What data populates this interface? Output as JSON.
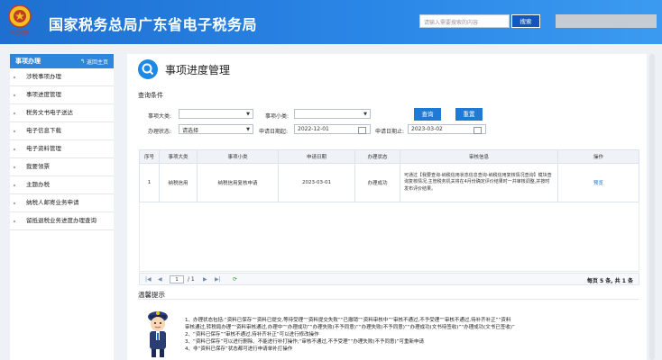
{
  "header": {
    "title": "国家税务总局广东省电子税务局",
    "emblem_text": "中国税务",
    "search_placeholder": "请输入需要搜索的内容",
    "search_button": "搜索"
  },
  "sidebar": {
    "title": "事项办理",
    "back_label": "返回主页",
    "items": [
      {
        "label": "涉税事项办理"
      },
      {
        "label": "事项进度管理"
      },
      {
        "label": "税务文书电子送达"
      },
      {
        "label": "电子信息下载"
      },
      {
        "label": "电子资料管理"
      },
      {
        "label": "我要领票"
      },
      {
        "label": "主题办税"
      },
      {
        "label": "纳税人邮寄业务申请"
      },
      {
        "label": "留抵退税业务进度办理查询"
      }
    ]
  },
  "page": {
    "title": "事项进度管理",
    "query_section": "查询条件"
  },
  "filters": {
    "category_label": "事项大类:",
    "category_value": "",
    "subcategory_label": "事项小类:",
    "subcategory_value": "",
    "status_label": "办理状态:",
    "status_value": "请选择",
    "start_label": "申请日期起:",
    "start_value": "2022-12-01",
    "end_label": "申请日期止:",
    "end_value": "2023-03-02",
    "query_button": "查询",
    "reset_button": "重置"
  },
  "table": {
    "columns": [
      "序号",
      "事项大类",
      "事项小类",
      "申请日期",
      "办理状态",
      "审核信息",
      "操作"
    ],
    "rows": [
      {
        "index": "1",
        "category": "纳税信用",
        "subcategory": "纳税信用复核申请",
        "date": "2023-03-01",
        "status": "办理成功",
        "info": "可通过【我要查询-纳税信用状态信息查询-纳税信用复核情况查询】模块查询复核情况,主管税务机关将在4月份确定评价结果时一并审核调整,并按时发布评价结果。",
        "action": "预览"
      }
    ]
  },
  "pager": {
    "first": "|◀",
    "prev": "◀",
    "page_value": "1",
    "page_total": "/ 1",
    "next": "▶",
    "last": "▶|",
    "refresh": "⟳",
    "summary": "每页 5 条, 共 1 条"
  },
  "tips": {
    "title": "温馨提示",
    "lines": [
      "1、办理状态包括:“资料已保存”“资料已提交,等待受理”“资料提交失败”“已撤销”“资料审核中”“审核不通过,不予受理”“审核不通过,待补齐补正”“资料",
      "审核通过,转税局办理”“资料审核通过,办理中”“办理成功”“办理失败(不予同意)”“办理失败(不予同意)”“办理成功(文书待签收)”“办理成功(文书已签收)”",
      "2、“资料已保存”“审核不通过,待补齐补正”可以进行修改操作",
      "3、“资料已保存”可以进行删除、不能进行补打操作;“审核不通过,不予受理”“办理失败(不予同意)”可重新申请",
      "4、非“资料已保存”状态都可进行申请单补打操作"
    ]
  },
  "colors": {
    "header_blue": "#2a86e6",
    "accent_button": "#1e7ad4",
    "link": "#1e6fd0"
  }
}
